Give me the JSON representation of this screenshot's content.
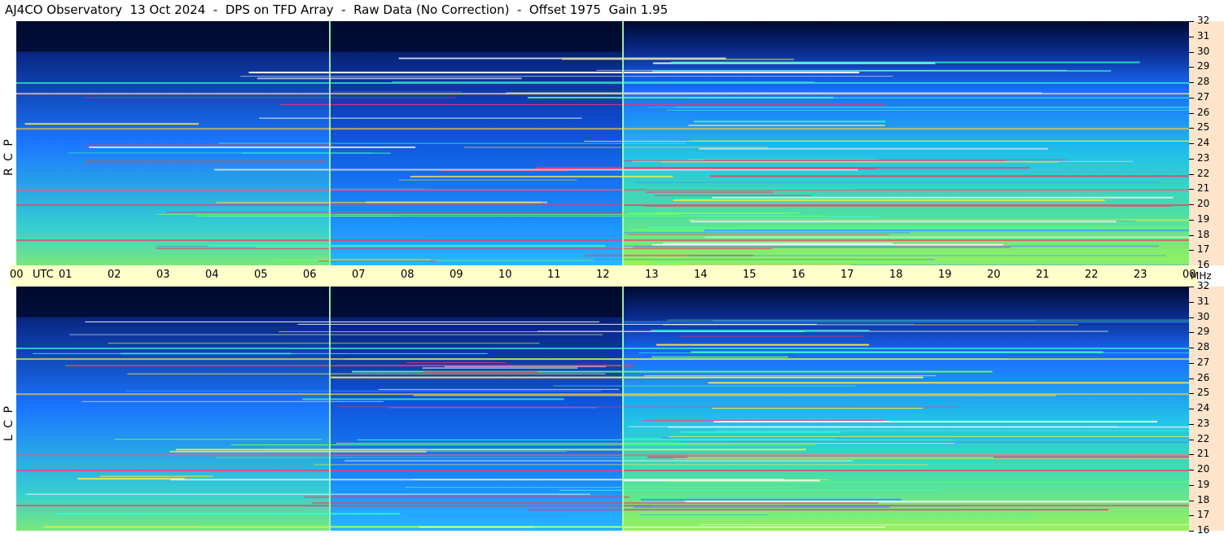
{
  "header": {
    "title": "AJ4CO Observatory  13 Oct 2024  -  DPS on TFD Array  -  Raw Data (No Correction)  -  Offset 1975  Gain 1.95"
  },
  "panels": [
    {
      "label": "R C P"
    },
    {
      "label": "L C P"
    }
  ],
  "time_axis": {
    "ticks": [
      "00",
      "01",
      "02",
      "03",
      "04",
      "05",
      "06",
      "07",
      "08",
      "09",
      "10",
      "11",
      "12",
      "13",
      "14",
      "15",
      "16",
      "17",
      "18",
      "19",
      "20",
      "21",
      "22",
      "23",
      "00"
    ],
    "utc_label": "UTC",
    "freq_unit": "MHz"
  },
  "chart_data": {
    "type": "heatmap",
    "title": "AJ4CO Observatory  13 Oct 2024  -  DPS on TFD Array  -  Raw Data (No Correction)  -  Offset 1975  Gain 1.95",
    "xlabel": "UTC",
    "ylabel": "MHz",
    "x_range_hours": [
      0,
      24
    ],
    "y_range_mhz": [
      16,
      32
    ],
    "y_ticks": [
      16,
      17,
      18,
      19,
      20,
      21,
      22,
      23,
      24,
      25,
      26,
      27,
      28,
      29,
      30,
      31,
      32
    ],
    "series": [
      {
        "name": "R C P",
        "vertical_markers_hours": [
          6.4,
          12.4
        ]
      },
      {
        "name": "L C P",
        "vertical_markers_hours": [
          6.4,
          12.4
        ]
      }
    ],
    "colors": {
      "low": "#000a2e",
      "mid": "#1a66ff",
      "high": "#33ffcc",
      "peak": "#ff3366",
      "freq_axis_bg": "#ffe4cc",
      "time_axis_bg": "#ffffcc"
    }
  }
}
